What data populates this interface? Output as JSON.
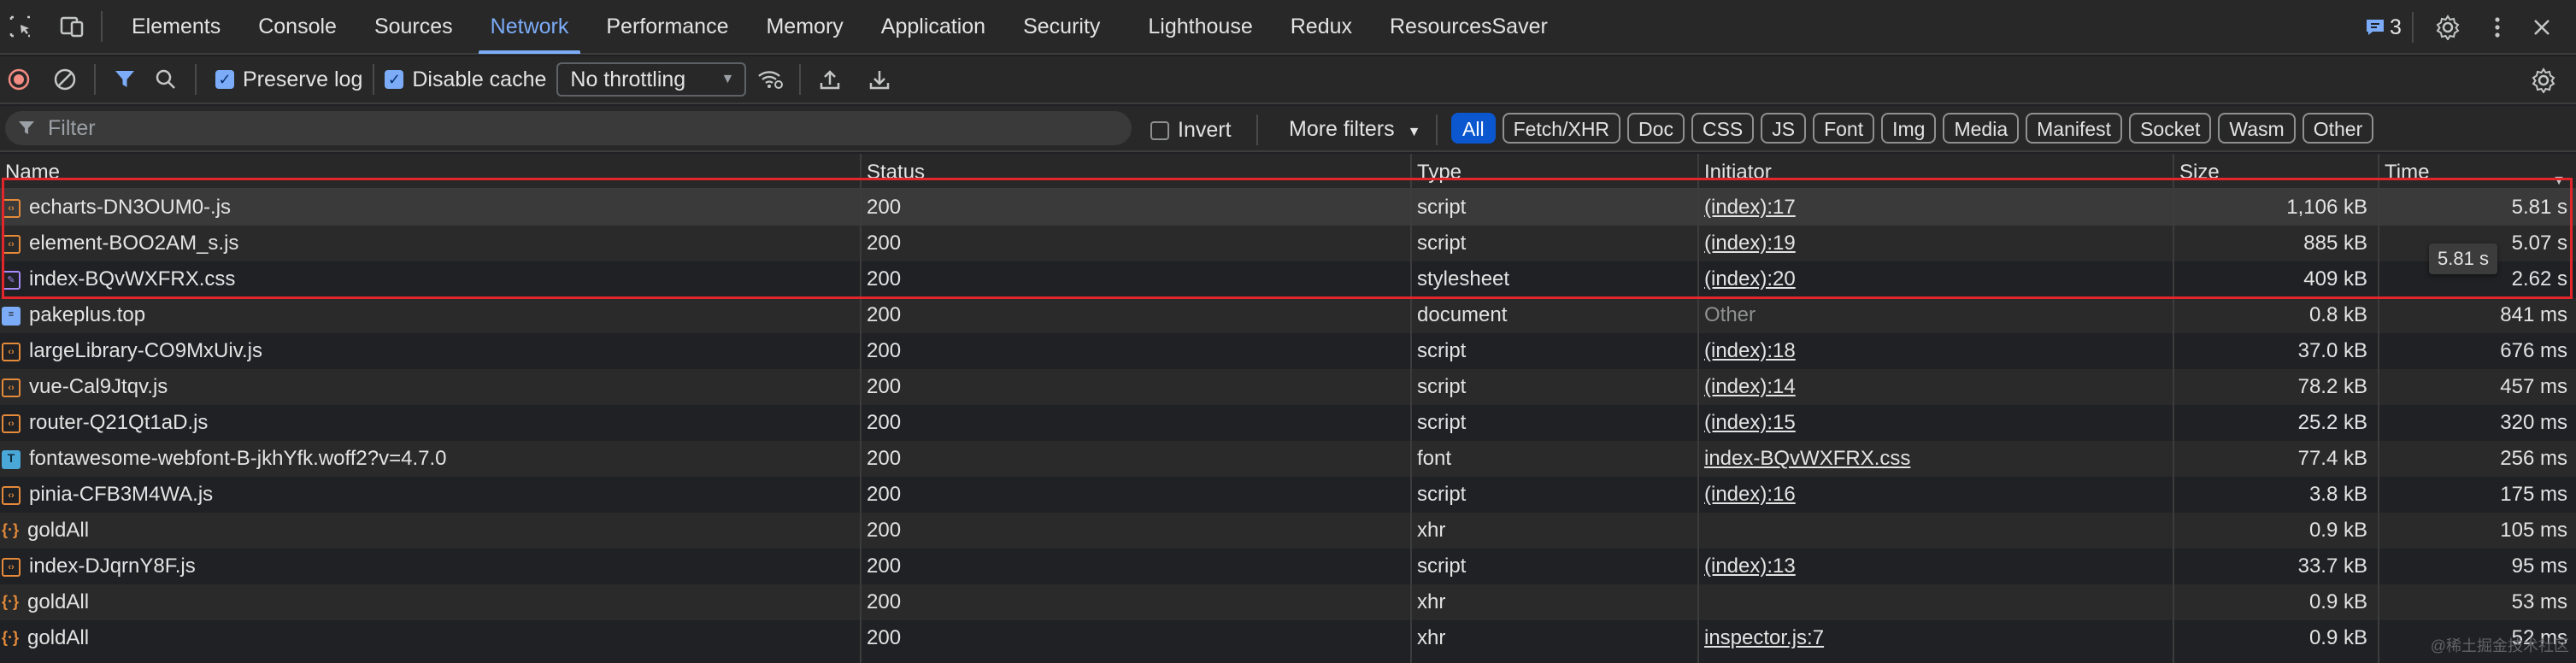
{
  "tabs": [
    "Elements",
    "Console",
    "Sources",
    "Network",
    "Performance",
    "Memory",
    "Application",
    "Security",
    "Lighthouse",
    "Redux",
    "ResourcesSaver"
  ],
  "active_tab": "Network",
  "issues_count": "3",
  "toolbar": {
    "preserve_log": "Preserve log",
    "disable_cache": "Disable cache",
    "throttling": "No throttling"
  },
  "filter": {
    "placeholder": "Filter",
    "invert": "Invert",
    "more_filters": "More filters",
    "chips": [
      "All",
      "Fetch/XHR",
      "Doc",
      "CSS",
      "JS",
      "Font",
      "Img",
      "Media",
      "Manifest",
      "Socket",
      "Wasm",
      "Other"
    ]
  },
  "columns": {
    "name": "Name",
    "status": "Status",
    "type": "Type",
    "initiator": "Initiator",
    "size": "Size",
    "time": "Time"
  },
  "rows": [
    {
      "name": "echarts-DN3OUM0-.js",
      "icon": "script",
      "status": "200",
      "type": "script",
      "initiator": "(index):17",
      "initiator_link": true,
      "size": "1,106 kB",
      "time": "5.81 s"
    },
    {
      "name": "element-BOO2AM_s.js",
      "icon": "script",
      "status": "200",
      "type": "script",
      "initiator": "(index):19",
      "initiator_link": true,
      "size": "885 kB",
      "time": "5.07 s"
    },
    {
      "name": "index-BQvWXFRX.css",
      "icon": "css",
      "status": "200",
      "type": "stylesheet",
      "initiator": "(index):20",
      "initiator_link": true,
      "size": "409 kB",
      "time": "2.62 s"
    },
    {
      "name": "pakeplus.top",
      "icon": "doc",
      "status": "200",
      "type": "document",
      "initiator": "Other",
      "initiator_link": false,
      "size": "0.8 kB",
      "time": "841 ms"
    },
    {
      "name": "largeLibrary-CO9MxUiv.js",
      "icon": "script",
      "status": "200",
      "type": "script",
      "initiator": "(index):18",
      "initiator_link": true,
      "size": "37.0 kB",
      "time": "676 ms"
    },
    {
      "name": "vue-Cal9Jtqv.js",
      "icon": "script",
      "status": "200",
      "type": "script",
      "initiator": "(index):14",
      "initiator_link": true,
      "size": "78.2 kB",
      "time": "457 ms"
    },
    {
      "name": "router-Q21Qt1aD.js",
      "icon": "script",
      "status": "200",
      "type": "script",
      "initiator": "(index):15",
      "initiator_link": true,
      "size": "25.2 kB",
      "time": "320 ms"
    },
    {
      "name": "fontawesome-webfont-B-jkhYfk.woff2?v=4.7.0",
      "icon": "font",
      "status": "200",
      "type": "font",
      "initiator": "index-BQvWXFRX.css",
      "initiator_link": true,
      "size": "77.4 kB",
      "time": "256 ms"
    },
    {
      "name": "pinia-CFB3M4WA.js",
      "icon": "script",
      "status": "200",
      "type": "script",
      "initiator": "(index):16",
      "initiator_link": true,
      "size": "3.8 kB",
      "time": "175 ms"
    },
    {
      "name": "goldAll",
      "icon": "xhr",
      "status": "200",
      "type": "xhr",
      "initiator": "",
      "initiator_link": false,
      "size": "0.9 kB",
      "time": "105 ms"
    },
    {
      "name": "index-DJqrnY8F.js",
      "icon": "script",
      "status": "200",
      "type": "script",
      "initiator": "(index):13",
      "initiator_link": true,
      "size": "33.7 kB",
      "time": "95 ms"
    },
    {
      "name": "goldAll",
      "icon": "xhr",
      "status": "200",
      "type": "xhr",
      "initiator": "",
      "initiator_link": false,
      "size": "0.9 kB",
      "time": "53 ms"
    },
    {
      "name": "goldAll",
      "icon": "xhr",
      "status": "200",
      "type": "xhr",
      "initiator": "inspector.js:7",
      "initiator_link": true,
      "size": "0.9 kB",
      "time": "52 ms"
    }
  ],
  "tooltip": "5.81 s",
  "watermark": "@稀土掘金技术社区",
  "colors": {
    "background": "#202124",
    "accent": "#7cacf8",
    "highlight_box": "#e3262b"
  }
}
